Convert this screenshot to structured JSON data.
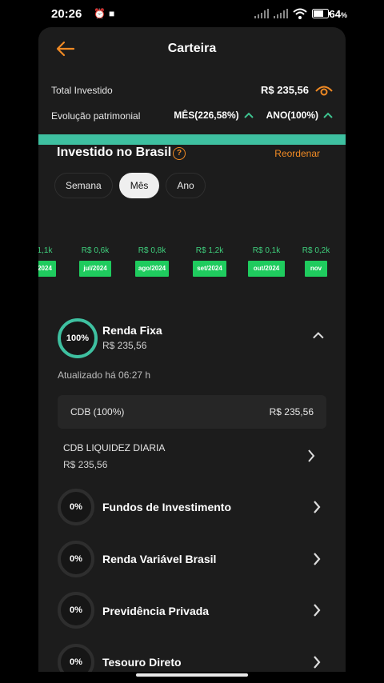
{
  "status_bar": {
    "time": "20:26",
    "battery": "64"
  },
  "header": {
    "title": "Carteira"
  },
  "summary": {
    "total_label": "Total Investido",
    "total_value": "R$ 235,56",
    "evolution_label": "Evolução patrimonial",
    "month": "MÊS(226,58%)",
    "year": "ANO(100%)"
  },
  "section": {
    "title": "Investido no Brasil",
    "help": "?",
    "reorder": "Reordenar"
  },
  "tabs": [
    {
      "label": "Semana",
      "active": false
    },
    {
      "label": "Mês",
      "active": true
    },
    {
      "label": "Ano",
      "active": false
    }
  ],
  "chart_data": {
    "type": "bar",
    "categories": [
      "2024",
      "jul/2024",
      "ago/2024",
      "set/2024",
      "out/2024",
      "nov"
    ],
    "value_labels": [
      "1,1k",
      "R$ 0,6k",
      "R$ 0,8k",
      "R$ 1,2k",
      "R$ 0,1k",
      "R$ 0,2k"
    ],
    "values": [
      1100,
      600,
      800,
      1200,
      100,
      200
    ]
  },
  "renda_fixa": {
    "percent": "100%",
    "name": "Renda Fixa",
    "value": "R$ 235,56"
  },
  "updated": "Atualizado há 06:27 h",
  "cdb": {
    "label": "CDB (100%)",
    "value": "R$ 235,56"
  },
  "cdb_liquidez": {
    "name": "CDB LIQUIDEZ DIARIA",
    "value": "R$ 235,56"
  },
  "categories": [
    {
      "percent": "0%",
      "name": "Fundos de Investimento"
    },
    {
      "percent": "0%",
      "name": "Renda Variável Brasil"
    },
    {
      "percent": "0%",
      "name": "Previdência Privada"
    },
    {
      "percent": "0%",
      "name": "Tesouro Direto"
    }
  ],
  "colors": {
    "accent": "#f08a24",
    "green": "#3ec0a0",
    "bar": "#1fcb5e"
  }
}
